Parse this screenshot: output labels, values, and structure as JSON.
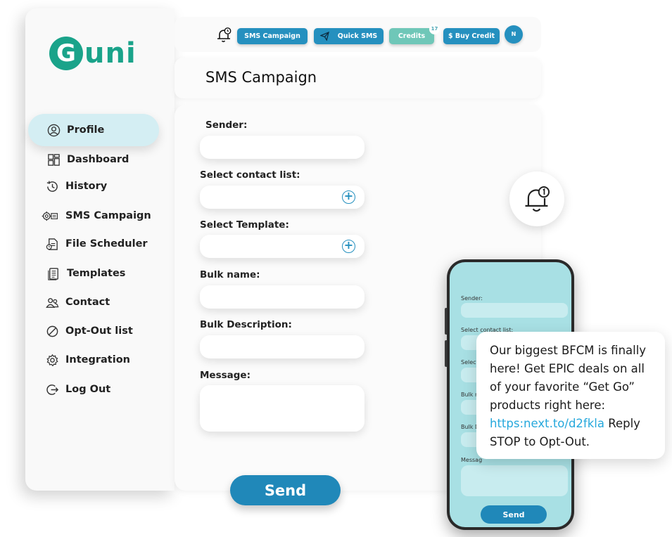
{
  "brand": {
    "logo_letter": "G",
    "logo_rest": "uni",
    "color": "#1aa38a"
  },
  "topbar": {
    "buttons": [
      {
        "label": "SMS Campaign",
        "icon": ""
      },
      {
        "label": "Quick SMS",
        "icon": "paper-plane-icon"
      },
      {
        "label": "Credits",
        "badge": "17"
      },
      {
        "label": "$ Buy Credit"
      }
    ],
    "avatar_initial": "N"
  },
  "sidebar": {
    "items": [
      {
        "label": "Profile",
        "icon": "user-circle-icon",
        "active": true
      },
      {
        "label": "Dashboard",
        "icon": "dashboard-grid-icon"
      },
      {
        "label": "History",
        "icon": "history-icon"
      },
      {
        "label": "SMS Campaign",
        "icon": "campaign-gear-icon"
      },
      {
        "label": "File Scheduler",
        "icon": "file-scheduler-icon"
      },
      {
        "label": "Templates",
        "icon": "templates-icon"
      },
      {
        "label": "Contact",
        "icon": "contacts-icon"
      },
      {
        "label": "Opt-Out list",
        "icon": "block-icon"
      },
      {
        "label": "Integration",
        "icon": "gear-icon"
      },
      {
        "label": "Log Out",
        "icon": "logout-icon"
      }
    ]
  },
  "page": {
    "title": "SMS Campaign"
  },
  "form": {
    "sender_label": "Sender:",
    "contact_label": "Select contact list:",
    "template_label": "Select Template:",
    "bulk_name_label": "Bulk name:",
    "bulk_desc_label": "Bulk Description:",
    "message_label": "Message:",
    "send_label": "Send"
  },
  "phone": {
    "labels": [
      "Sender:",
      "Select contact list:",
      "Select",
      "Bulk n",
      "Bulk D",
      "Messag"
    ],
    "send_label": "Send"
  },
  "bubble": {
    "text": "Our biggest BFCM is finally here! Get EPIC deals on all of your favorite “Get Go” products right here:",
    "link": "https:next.to/d2fkla",
    "text_after": "Reply STOP to Opt-Out."
  },
  "colors": {
    "accent": "#2590bf",
    "active_nav": "#d4eef3",
    "phone_screen": "#a8e0e4"
  }
}
